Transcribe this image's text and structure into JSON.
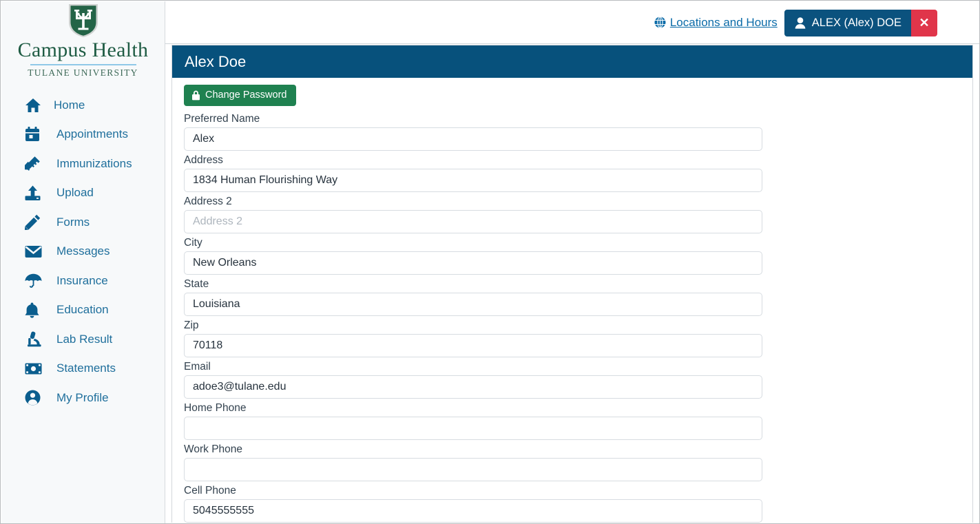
{
  "brand": {
    "logo_icon": "tulane-shield-icon",
    "name": "Campus Health",
    "subtitle": "TULANE UNIVERSITY"
  },
  "sidebar": {
    "items": [
      {
        "label": "Home",
        "icon": "home-icon",
        "key": "home"
      },
      {
        "label": "Appointments",
        "icon": "calendar-icon",
        "key": "appointments"
      },
      {
        "label": "Immunizations",
        "icon": "syringe-icon",
        "key": "immunizations"
      },
      {
        "label": "Upload",
        "icon": "upload-icon",
        "key": "upload"
      },
      {
        "label": "Forms",
        "icon": "pencil-icon",
        "key": "forms"
      },
      {
        "label": "Messages",
        "icon": "envelope-icon",
        "key": "messages"
      },
      {
        "label": "Insurance",
        "icon": "umbrella-icon",
        "key": "insurance"
      },
      {
        "label": "Education",
        "icon": "bell-icon",
        "key": "education"
      },
      {
        "label": "Lab Result",
        "icon": "microscope-icon",
        "key": "lab-result"
      },
      {
        "label": "Statements",
        "icon": "money-bill-icon",
        "key": "statements"
      },
      {
        "label": "My Profile",
        "icon": "user-circle-icon",
        "key": "my-profile"
      }
    ]
  },
  "header": {
    "locations_link": "Locations and Hours",
    "locations_icon": "globe-icon",
    "user_name": "ALEX (Alex) DOE",
    "user_icon": "user-icon",
    "close_label": "✕",
    "close_icon": "close-icon"
  },
  "panel": {
    "title": "Alex Doe",
    "change_password_label": "Change Password",
    "change_password_icon": "lock-icon"
  },
  "form": {
    "fields": [
      {
        "label": "Preferred Name",
        "value": "Alex",
        "placeholder": ""
      },
      {
        "label": "Address",
        "value": "1834 Human Flourishing Way",
        "placeholder": ""
      },
      {
        "label": "Address 2",
        "value": "",
        "placeholder": "Address 2"
      },
      {
        "label": "City",
        "value": "New Orleans",
        "placeholder": ""
      },
      {
        "label": "State",
        "value": "Louisiana",
        "placeholder": ""
      },
      {
        "label": "Zip",
        "value": "70118",
        "placeholder": ""
      },
      {
        "label": "Email",
        "value": "adoe3@tulane.edu",
        "placeholder": ""
      },
      {
        "label": "Home Phone",
        "value": "",
        "placeholder": ""
      },
      {
        "label": "Work Phone",
        "value": "",
        "placeholder": ""
      },
      {
        "label": "Cell Phone",
        "value": "5045555555",
        "placeholder": ""
      }
    ]
  },
  "colors": {
    "brand_green": "#1f5c44",
    "panel_blue": "#07517c",
    "nav_blue": "#1f6f9c",
    "icon_blue": "#0b5e8e",
    "button_green": "#1f8150",
    "close_red": "#e0354a",
    "sidebar_bg": "#f7f9fa"
  }
}
